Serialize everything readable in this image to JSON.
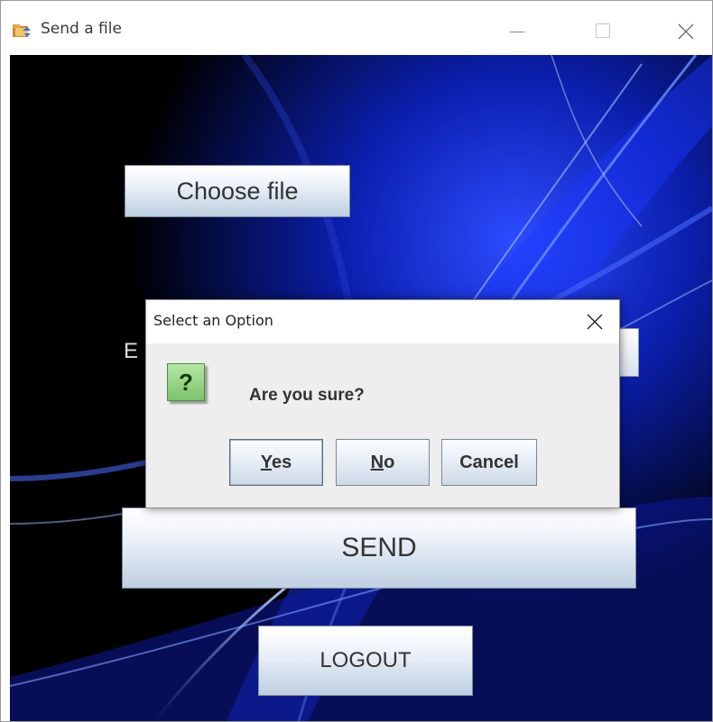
{
  "window": {
    "title": "Send a file",
    "icon": "folder-send-icon"
  },
  "main": {
    "choose_file_label": "Choose file",
    "email_label_fragment": "E",
    "send_label": "SEND",
    "logout_label": "LOGOUT"
  },
  "dialog": {
    "title": "Select an Option",
    "message": "Are you sure?",
    "icon": "question-icon",
    "buttons": {
      "yes_first": "Y",
      "yes_rest": "es",
      "no_first": "N",
      "no_rest": "o",
      "cancel": "Cancel"
    }
  },
  "colors": {
    "background": "#000000",
    "accent_blue": "#1a3cff",
    "question_icon_green": "#8fd07c"
  }
}
